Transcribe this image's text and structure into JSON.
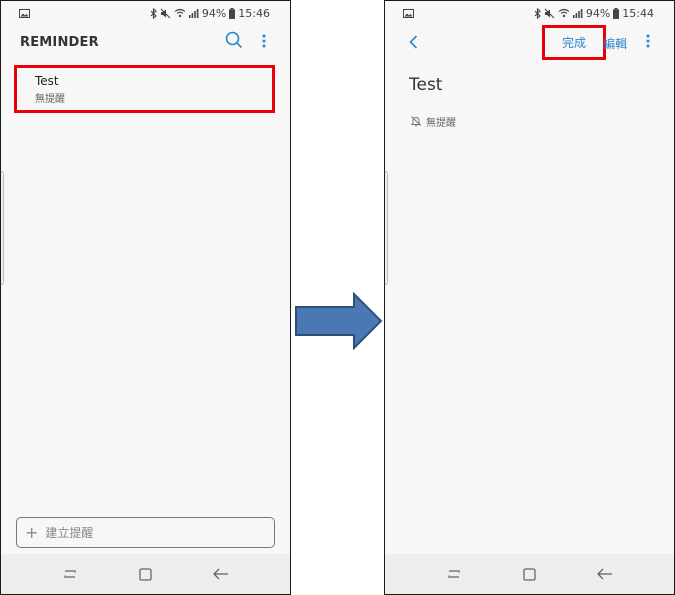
{
  "left": {
    "status": {
      "battery": "94%",
      "time": "15:46"
    },
    "app_title": "REMINDER",
    "reminder_item": {
      "title": "Test",
      "subtitle": "無提醒"
    },
    "add_bar": {
      "plus": "+",
      "placeholder": "建立提醒"
    }
  },
  "right": {
    "status": {
      "battery": "94%",
      "time": "15:44"
    },
    "done_label": "完成",
    "edit_label": "編輯",
    "detail": {
      "title": "Test",
      "reminder_text": "無提醒"
    }
  },
  "colors": {
    "accent": "#2d86c9",
    "highlight": "#e8000a",
    "arrow_fill": "#4a78b5",
    "arrow_stroke": "#2e4f78"
  }
}
